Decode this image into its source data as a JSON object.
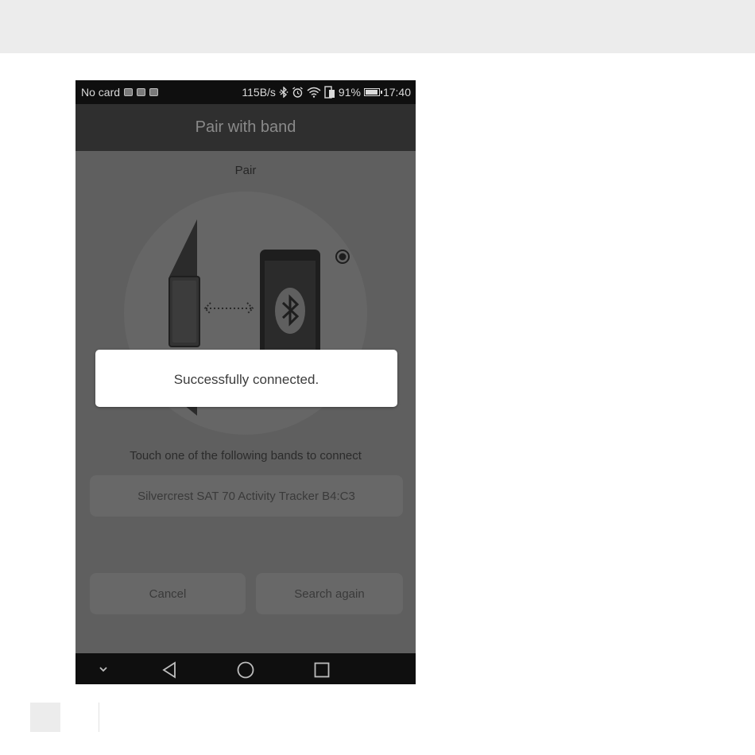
{
  "status_bar": {
    "carrier": "No card",
    "net_speed": "115B/s",
    "battery_percent": "91%",
    "time": "17:40",
    "icons": [
      "notification-icon",
      "image-icon",
      "image-icon",
      "bluetooth-icon",
      "alarm-icon",
      "wifi-icon",
      "sim-icon",
      "battery-icon"
    ]
  },
  "app_bar": {
    "title": "Pair with band"
  },
  "main": {
    "step_label": "Pair",
    "illustration": {
      "elements": [
        "band-icon",
        "dotted-arrow-icon",
        "phone-icon",
        "bluetooth-icon",
        "radio-dot-icon"
      ]
    },
    "prompt": "Touch one of the following bands to connect",
    "devices": [
      {
        "label": "Silvercrest SAT 70 Activity Tracker B4:C3"
      }
    ],
    "buttons": {
      "cancel": "Cancel",
      "search_again": "Search again"
    }
  },
  "toast": {
    "message": "Successfully connected."
  },
  "nav_bar": {
    "icons": [
      "chevron-down-icon",
      "back-icon",
      "home-icon",
      "recents-icon"
    ]
  },
  "colors": {
    "dim_overlay": "#5f5f5f",
    "status_bar": "#0f0f0f",
    "app_bar": "#2f2f2f",
    "toast_bg": "#ffffff"
  }
}
